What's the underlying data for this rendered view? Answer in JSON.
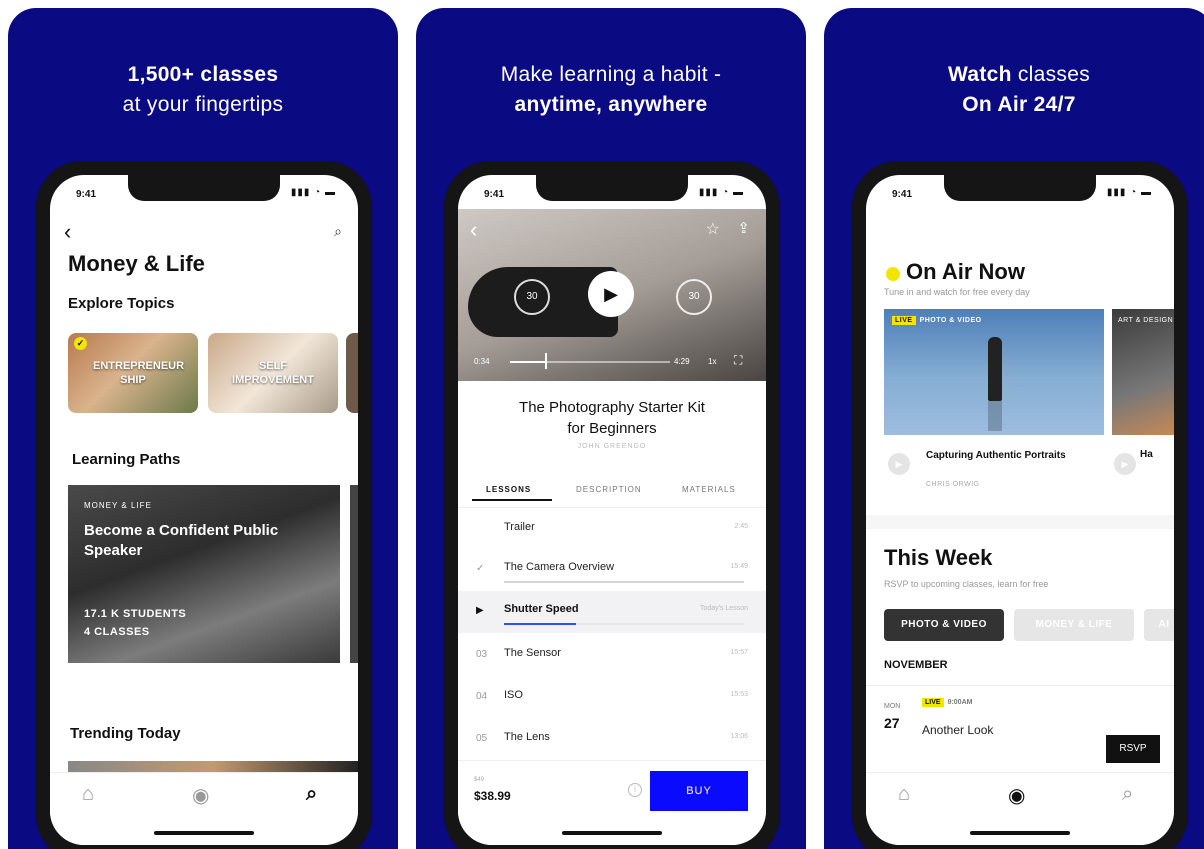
{
  "panels": [
    {
      "headline_line1": "1,500+ classes",
      "headline_line2": "at your fingertips"
    },
    {
      "headline_line1": "Make learning a habit -",
      "headline_line2": "anytime, anywhere"
    },
    {
      "headline_bold1": "Watch",
      "headline_rest1": " classes",
      "headline_line2": "On Air 24/7"
    }
  ],
  "status_time": "9:41",
  "screen1": {
    "title": "Money & Life",
    "explore_label": "Explore Topics",
    "topics": [
      "ENTREPRENEUR SHIP",
      "SELF IMPROVEMENT"
    ],
    "learning_paths_label": "Learning Paths",
    "path": {
      "category": "MONEY & LIFE",
      "title": "Become a Confident Public Speaker",
      "students": "17.1 K STUDENTS",
      "classes": "4 CLASSES"
    },
    "trending_label": "Trending Today"
  },
  "screen2": {
    "video_time_elapsed": "0:34",
    "video_time_remaining": "4:29",
    "video_speed": "1x",
    "video_progress": 0.22,
    "skip_back": "30",
    "skip_fwd": "30",
    "course_title_line1": "The Photography Starter Kit",
    "course_title_line2": "for Beginners",
    "author": "JOHN GREENGO",
    "tabs": [
      "LESSONS",
      "DESCRIPTION",
      "MATERIALS"
    ],
    "lessons": [
      {
        "num": "",
        "name": "Trailer",
        "duration": "2:45",
        "progress": 0
      },
      {
        "num": "✓",
        "name": "The Camera Overview",
        "duration": "15:49",
        "progress": 1.0
      },
      {
        "num": "▶",
        "name": "Shutter Speed",
        "duration": "Today's Lesson",
        "progress": 0.3
      },
      {
        "num": "03",
        "name": "The Sensor",
        "duration": "15:57",
        "progress": 0
      },
      {
        "num": "04",
        "name": "ISO",
        "duration": "15:53",
        "progress": 0
      },
      {
        "num": "05",
        "name": "The Lens",
        "duration": "13:06",
        "progress": 0
      }
    ],
    "old_price": "$49",
    "price": "$38.99",
    "buy_label": "BUY"
  },
  "screen3": {
    "on_air_title": "On Air Now",
    "on_air_sub": "Tune in and watch for free every day",
    "live_tag": "LIVE",
    "live_category": "PHOTO & VIDEO",
    "live_category2": "ART & DESIGN",
    "card_title": "Capturing Authentic Portraits",
    "card_author": "CHRIS ORWIG",
    "card_title2": "Ha",
    "this_week": "This Week",
    "this_week_sub": "RSVP to upcoming classes, learn for free",
    "chips": [
      "PHOTO & VIDEO",
      "MONEY & LIFE",
      "AI"
    ],
    "month": "NOVEMBER",
    "event": {
      "day": "MON",
      "date": "27",
      "live": "LIVE",
      "time": "9:00AM",
      "title": "Another Look"
    },
    "rsvp_label": "RSVP"
  },
  "colors": {
    "panel_bg": "#0a0a82",
    "accent_blue": "#0a0aff",
    "live_yellow": "#f2e600"
  },
  "icons": [
    "back-arrow-icon",
    "search-icon",
    "home-icon",
    "on-air-icon",
    "star-icon",
    "share-icon",
    "play-icon",
    "skip-back-icon",
    "skip-forward-icon",
    "fullscreen-icon",
    "check-icon",
    "info-icon"
  ]
}
